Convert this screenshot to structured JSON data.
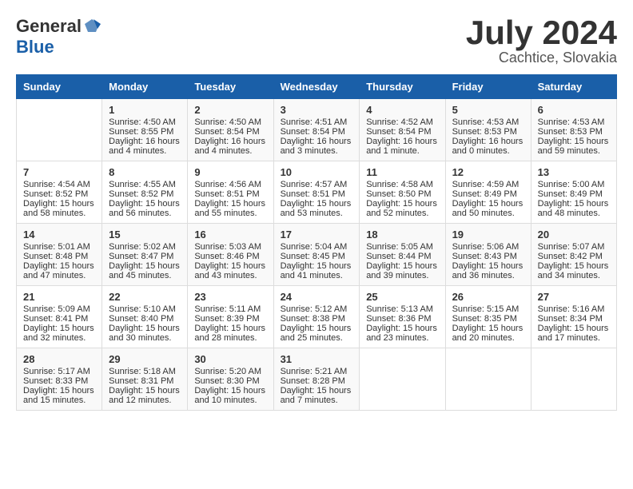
{
  "header": {
    "logo_general": "General",
    "logo_blue": "Blue",
    "month_year": "July 2024",
    "location": "Cachtice, Slovakia"
  },
  "columns": [
    "Sunday",
    "Monday",
    "Tuesday",
    "Wednesday",
    "Thursday",
    "Friday",
    "Saturday"
  ],
  "weeks": [
    [
      {
        "day": "",
        "lines": []
      },
      {
        "day": "1",
        "lines": [
          "Sunrise: 4:50 AM",
          "Sunset: 8:55 PM",
          "Daylight: 16 hours",
          "and 4 minutes."
        ]
      },
      {
        "day": "2",
        "lines": [
          "Sunrise: 4:50 AM",
          "Sunset: 8:54 PM",
          "Daylight: 16 hours",
          "and 4 minutes."
        ]
      },
      {
        "day": "3",
        "lines": [
          "Sunrise: 4:51 AM",
          "Sunset: 8:54 PM",
          "Daylight: 16 hours",
          "and 3 minutes."
        ]
      },
      {
        "day": "4",
        "lines": [
          "Sunrise: 4:52 AM",
          "Sunset: 8:54 PM",
          "Daylight: 16 hours",
          "and 1 minute."
        ]
      },
      {
        "day": "5",
        "lines": [
          "Sunrise: 4:53 AM",
          "Sunset: 8:53 PM",
          "Daylight: 16 hours",
          "and 0 minutes."
        ]
      },
      {
        "day": "6",
        "lines": [
          "Sunrise: 4:53 AM",
          "Sunset: 8:53 PM",
          "Daylight: 15 hours",
          "and 59 minutes."
        ]
      }
    ],
    [
      {
        "day": "7",
        "lines": [
          "Sunrise: 4:54 AM",
          "Sunset: 8:52 PM",
          "Daylight: 15 hours",
          "and 58 minutes."
        ]
      },
      {
        "day": "8",
        "lines": [
          "Sunrise: 4:55 AM",
          "Sunset: 8:52 PM",
          "Daylight: 15 hours",
          "and 56 minutes."
        ]
      },
      {
        "day": "9",
        "lines": [
          "Sunrise: 4:56 AM",
          "Sunset: 8:51 PM",
          "Daylight: 15 hours",
          "and 55 minutes."
        ]
      },
      {
        "day": "10",
        "lines": [
          "Sunrise: 4:57 AM",
          "Sunset: 8:51 PM",
          "Daylight: 15 hours",
          "and 53 minutes."
        ]
      },
      {
        "day": "11",
        "lines": [
          "Sunrise: 4:58 AM",
          "Sunset: 8:50 PM",
          "Daylight: 15 hours",
          "and 52 minutes."
        ]
      },
      {
        "day": "12",
        "lines": [
          "Sunrise: 4:59 AM",
          "Sunset: 8:49 PM",
          "Daylight: 15 hours",
          "and 50 minutes."
        ]
      },
      {
        "day": "13",
        "lines": [
          "Sunrise: 5:00 AM",
          "Sunset: 8:49 PM",
          "Daylight: 15 hours",
          "and 48 minutes."
        ]
      }
    ],
    [
      {
        "day": "14",
        "lines": [
          "Sunrise: 5:01 AM",
          "Sunset: 8:48 PM",
          "Daylight: 15 hours",
          "and 47 minutes."
        ]
      },
      {
        "day": "15",
        "lines": [
          "Sunrise: 5:02 AM",
          "Sunset: 8:47 PM",
          "Daylight: 15 hours",
          "and 45 minutes."
        ]
      },
      {
        "day": "16",
        "lines": [
          "Sunrise: 5:03 AM",
          "Sunset: 8:46 PM",
          "Daylight: 15 hours",
          "and 43 minutes."
        ]
      },
      {
        "day": "17",
        "lines": [
          "Sunrise: 5:04 AM",
          "Sunset: 8:45 PM",
          "Daylight: 15 hours",
          "and 41 minutes."
        ]
      },
      {
        "day": "18",
        "lines": [
          "Sunrise: 5:05 AM",
          "Sunset: 8:44 PM",
          "Daylight: 15 hours",
          "and 39 minutes."
        ]
      },
      {
        "day": "19",
        "lines": [
          "Sunrise: 5:06 AM",
          "Sunset: 8:43 PM",
          "Daylight: 15 hours",
          "and 36 minutes."
        ]
      },
      {
        "day": "20",
        "lines": [
          "Sunrise: 5:07 AM",
          "Sunset: 8:42 PM",
          "Daylight: 15 hours",
          "and 34 minutes."
        ]
      }
    ],
    [
      {
        "day": "21",
        "lines": [
          "Sunrise: 5:09 AM",
          "Sunset: 8:41 PM",
          "Daylight: 15 hours",
          "and 32 minutes."
        ]
      },
      {
        "day": "22",
        "lines": [
          "Sunrise: 5:10 AM",
          "Sunset: 8:40 PM",
          "Daylight: 15 hours",
          "and 30 minutes."
        ]
      },
      {
        "day": "23",
        "lines": [
          "Sunrise: 5:11 AM",
          "Sunset: 8:39 PM",
          "Daylight: 15 hours",
          "and 28 minutes."
        ]
      },
      {
        "day": "24",
        "lines": [
          "Sunrise: 5:12 AM",
          "Sunset: 8:38 PM",
          "Daylight: 15 hours",
          "and 25 minutes."
        ]
      },
      {
        "day": "25",
        "lines": [
          "Sunrise: 5:13 AM",
          "Sunset: 8:36 PM",
          "Daylight: 15 hours",
          "and 23 minutes."
        ]
      },
      {
        "day": "26",
        "lines": [
          "Sunrise: 5:15 AM",
          "Sunset: 8:35 PM",
          "Daylight: 15 hours",
          "and 20 minutes."
        ]
      },
      {
        "day": "27",
        "lines": [
          "Sunrise: 5:16 AM",
          "Sunset: 8:34 PM",
          "Daylight: 15 hours",
          "and 17 minutes."
        ]
      }
    ],
    [
      {
        "day": "28",
        "lines": [
          "Sunrise: 5:17 AM",
          "Sunset: 8:33 PM",
          "Daylight: 15 hours",
          "and 15 minutes."
        ]
      },
      {
        "day": "29",
        "lines": [
          "Sunrise: 5:18 AM",
          "Sunset: 8:31 PM",
          "Daylight: 15 hours",
          "and 12 minutes."
        ]
      },
      {
        "day": "30",
        "lines": [
          "Sunrise: 5:20 AM",
          "Sunset: 8:30 PM",
          "Daylight: 15 hours",
          "and 10 minutes."
        ]
      },
      {
        "day": "31",
        "lines": [
          "Sunrise: 5:21 AM",
          "Sunset: 8:28 PM",
          "Daylight: 15 hours",
          "and 7 minutes."
        ]
      },
      {
        "day": "",
        "lines": []
      },
      {
        "day": "",
        "lines": []
      },
      {
        "day": "",
        "lines": []
      }
    ]
  ]
}
